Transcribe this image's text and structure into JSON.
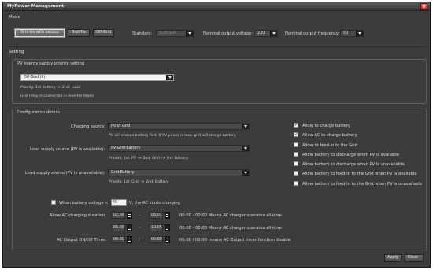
{
  "window": {
    "title": "MyPower Management",
    "close": "×"
  },
  "mode": {
    "label": "Mode",
    "buttons": [
      "Grid-tie with backup",
      "Grid-Tie",
      "Off-Grid"
    ],
    "standard_label": "Standard:",
    "standard_value": "VDE0126",
    "nominal_voltage_label": "Nominal output voltage:",
    "nominal_voltage_value": "230",
    "nominal_freq_label": "Nominal output frequency:",
    "nominal_freq_value": "50"
  },
  "setting": {
    "label": "Setting",
    "pv_priority": {
      "label": "PV energy supply priority setting",
      "selected": "Off-Grid (II)",
      "priority": "Priority: 1st Battery -> 2nd: Load",
      "relay": "Grid relay is connected in inverter mode"
    },
    "config": {
      "label": "Configuration details",
      "charging_source_label": "Charging source:",
      "charging_source_value": "PV or Grid",
      "charging_note": "PV will charge battery first. If PV power is loss, grid will charge battery.",
      "load_pv_label": "Load supply source (PV is available):",
      "load_pv_value": "PV-Grid-Battery",
      "load_pv_note": "Priority: 1st: PV -> 2nd: Grid -> 3rd: Battery",
      "load_nopv_label": "Load supply source (PV is unavailable):",
      "load_nopv_value": "Grid-Battery",
      "load_nopv_note": "Priority: 1st: Grid -> 2nd: Battery",
      "checks": [
        {
          "label": "Allow to charge battery",
          "checked": true
        },
        {
          "label": "Allow AC to charge battery",
          "checked": true
        },
        {
          "label": "Allow to feed-in to the Grid",
          "checked": false
        },
        {
          "label": "Allow battery to discharge when PV is available",
          "checked": false
        },
        {
          "label": "Allow battery to discharge when PV is unavailable",
          "checked": false
        },
        {
          "label": "Allow battery to feed-in to the Grid when PV is available",
          "checked": false
        },
        {
          "label": "Allow battery to feed-in to the Grid when PV is unavailable",
          "checked": false
        }
      ],
      "battery_voltage": {
        "prefix": "When battery voltage <",
        "value": "40",
        "suffix": "V, the AC starts charging"
      },
      "ac_charging": {
        "label": "Allow AC charging duration",
        "row1": {
          "start": "02:00",
          "sep": "-",
          "end": "03:01",
          "note": "00:00 - 00:00 Means AC charger operates all-time"
        },
        "row2": {
          "start": "05:00",
          "sep": "-",
          "end": "10:05",
          "note": "00:00 - 00:00 Means AC charger operates all-time"
        }
      },
      "ac_output": {
        "label": "AC Output ON/Off Timer:",
        "start": "00:00",
        "sep": "/",
        "end": "00:00",
        "note": "00:00 / 00:00 means AC Output timer function disable"
      }
    }
  },
  "actions": {
    "apply": "Apply",
    "close": "Close"
  }
}
